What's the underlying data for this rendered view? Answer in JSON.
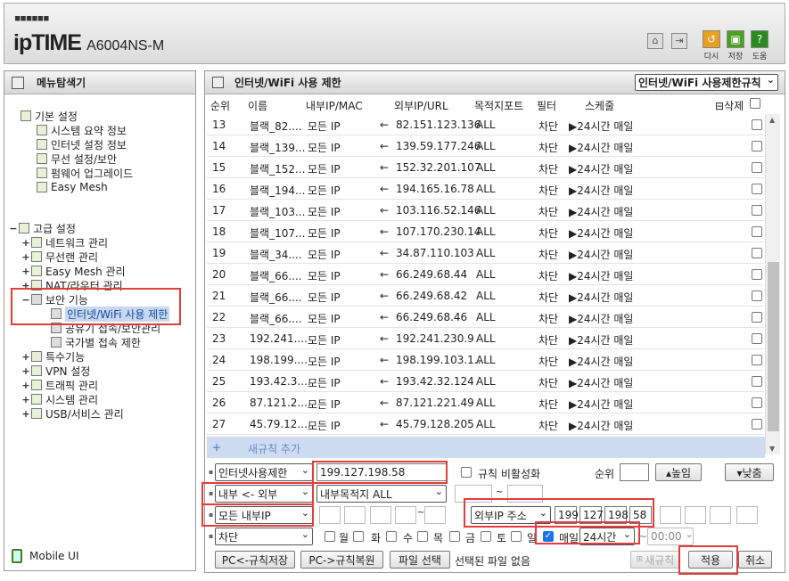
{
  "header": {
    "logo_dots": "■■■■■■",
    "brand": "ipTIME",
    "model": "A6004NS-M",
    "buttons": [
      {
        "label": "다시",
        "icon": "refresh-icon",
        "color": "#e8a020"
      },
      {
        "label": "저장",
        "icon": "save-icon",
        "color": "#4aa020"
      },
      {
        "label": "도움",
        "icon": "help-icon",
        "color": "#2a8a20"
      }
    ]
  },
  "sidebar": {
    "title": "메뉴탐색기",
    "basic": {
      "label": "기본 설정",
      "items": [
        "시스템 요약 정보",
        "인터넷 설정 정보",
        "무선 설정/보안",
        "펌웨어 업그레이드",
        "Easy Mesh"
      ]
    },
    "advanced": {
      "label": "고급 설정",
      "expand": "−",
      "items": [
        {
          "label": "네트워크 관리",
          "expand": "+"
        },
        {
          "label": "무선랜 관리",
          "expand": "+"
        },
        {
          "label": "Easy Mesh 관리",
          "expand": "+"
        },
        {
          "label": "NAT/라우터 관리",
          "expand": "+"
        },
        {
          "label": "보안 기능",
          "expand": "−"
        }
      ],
      "security_children": [
        "인터넷/WiFi 사용 제한",
        "공유기 접속/보안관리",
        "국가별 접속 제한"
      ],
      "more": [
        {
          "label": "특수기능",
          "expand": "+"
        },
        {
          "label": "VPN 설정",
          "expand": "+"
        },
        {
          "label": "트래픽 관리",
          "expand": "+"
        },
        {
          "label": "시스템 관리",
          "expand": "+"
        },
        {
          "label": "USB/서비스 관리",
          "expand": "+"
        }
      ]
    },
    "mobile": "Mobile UI"
  },
  "main": {
    "title": "인터넷/WiFi 사용 제한",
    "mode_select": "인터넷/WiFi 사용제한규칙",
    "columns": [
      "순위",
      "이름",
      "내부IP/MAC",
      "외부IP/URL",
      "목적지포트",
      "필터",
      "스케줄",
      "삭제"
    ],
    "rows": [
      {
        "rank": "13",
        "name": "블랙_82....",
        "inner": "모든 IP",
        "outer": "82.151.123.136",
        "port": "ALL",
        "filter": "차단",
        "sched": "▶24시간 매일"
      },
      {
        "rank": "14",
        "name": "블랙_139...",
        "inner": "모든 IP",
        "outer": "139.59.177.246",
        "port": "ALL",
        "filter": "차단",
        "sched": "▶24시간 매일"
      },
      {
        "rank": "15",
        "name": "블랙_152...",
        "inner": "모든 IP",
        "outer": "152.32.201.107",
        "port": "ALL",
        "filter": "차단",
        "sched": "▶24시간 매일"
      },
      {
        "rank": "16",
        "name": "블랙_194...",
        "inner": "모든 IP",
        "outer": "194.165.16.78",
        "port": "ALL",
        "filter": "차단",
        "sched": "▶24시간 매일"
      },
      {
        "rank": "17",
        "name": "블랙_103...",
        "inner": "모든 IP",
        "outer": "103.116.52.146",
        "port": "ALL",
        "filter": "차단",
        "sched": "▶24시간 매일"
      },
      {
        "rank": "18",
        "name": "블랙_107...",
        "inner": "모든 IP",
        "outer": "107.170.230.14",
        "port": "ALL",
        "filter": "차단",
        "sched": "▶24시간 매일"
      },
      {
        "rank": "19",
        "name": "블랙_34....",
        "inner": "모든 IP",
        "outer": "34.87.110.103",
        "port": "ALL",
        "filter": "차단",
        "sched": "▶24시간 매일"
      },
      {
        "rank": "20",
        "name": "블랙_66....",
        "inner": "모든 IP",
        "outer": "66.249.68.44",
        "port": "ALL",
        "filter": "차단",
        "sched": "▶24시간 매일"
      },
      {
        "rank": "21",
        "name": "블랙_66....",
        "inner": "모든 IP",
        "outer": "66.249.68.42",
        "port": "ALL",
        "filter": "차단",
        "sched": "▶24시간 매일"
      },
      {
        "rank": "22",
        "name": "블랙_66....",
        "inner": "모든 IP",
        "outer": "66.249.68.46",
        "port": "ALL",
        "filter": "차단",
        "sched": "▶24시간 매일"
      },
      {
        "rank": "23",
        "name": "192.241....",
        "inner": "모든 IP",
        "outer": "192.241.230.9",
        "port": "ALL",
        "filter": "차단",
        "sched": "▶24시간 매일"
      },
      {
        "rank": "24",
        "name": "198.199....",
        "inner": "모든 IP",
        "outer": "198.199.103.1...",
        "port": "ALL",
        "filter": "차단",
        "sched": "▶24시간 매일"
      },
      {
        "rank": "25",
        "name": "193.42.3....",
        "inner": "모든 IP",
        "outer": "193.42.32.124",
        "port": "ALL",
        "filter": "차단",
        "sched": "▶24시간 매일"
      },
      {
        "rank": "26",
        "name": "87.121.2....",
        "inner": "모든 IP",
        "outer": "87.121.221.49",
        "port": "ALL",
        "filter": "차단",
        "sched": "▶24시간 매일"
      },
      {
        "rank": "27",
        "name": "45.79.12....",
        "inner": "모든 IP",
        "outer": "45.79.128.205",
        "port": "ALL",
        "filter": "차단",
        "sched": "▶24시간 매일"
      }
    ],
    "arrow": "←",
    "new_rule": {
      "plus": "+",
      "label": "새규칙 추가"
    }
  },
  "form": {
    "rule_type": "인터넷사용제한",
    "rule_name": "199.127.198.58",
    "disable_label": "규칙 비활성화",
    "rank_label": "순위",
    "rank_value": "",
    "up_btn": "▴높임",
    "down_btn": "▾낮춤",
    "direction": "내부 <- 외부",
    "dest": "내부목적지 ALL",
    "port_sep": "~",
    "inner_ip": "모든 내부IP",
    "ip_sep": "~",
    "outer_type": "외부IP 주소",
    "outer_ip": [
      "199",
      "127",
      "198",
      "58"
    ],
    "action": "차단",
    "days": [
      "월",
      "화",
      "수",
      "목",
      "금",
      "토",
      "일"
    ],
    "daily_label": "매일",
    "time_select": "24시간",
    "time_sep": "~",
    "time_end": "00:00",
    "btn_backup": "PC<-규칙저장",
    "btn_restore": "PC->규칙복원",
    "btn_file": "파일 선택",
    "file_status": "선택된 파일 없음",
    "btn_newrule": "새규칙",
    "btn_apply": "적용",
    "btn_cancel": "취소"
  }
}
